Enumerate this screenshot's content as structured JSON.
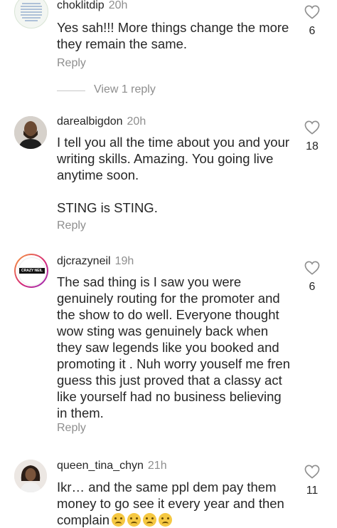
{
  "comments": [
    {
      "username": "choklitdip",
      "time": "20h",
      "paragraphs": [
        "Yes sah!!! More things change the more they remain the same."
      ],
      "reply_label": "Reply",
      "likes": "6",
      "view_replies": "View 1 reply"
    },
    {
      "username": "darealbigdon",
      "time": "20h",
      "paragraphs": [
        "I tell you all the time about you and your writing skills. Amazing. You going live anytime soon.",
        "STING is STING."
      ],
      "reply_label": "Reply",
      "likes": "18"
    },
    {
      "username": "djcrazyneil",
      "time": "19h",
      "paragraphs": [
        "The sad thing is I saw you were genuinely routing for the promoter and the show to do well. Everyone thought wow sting was genuinely back when they saw legends like you booked and promoting it . Nuh worry youself me fren guess this just proved that a classy act like yourself had no business believing in them."
      ],
      "reply_label": "Reply",
      "likes": "6",
      "avatar_logo_text": "CRAZY NEIL"
    },
    {
      "username": "queen_tina_chyn",
      "time": "21h",
      "paragraphs": [
        "Ikr… and the same ppl dem pay them money to go see it every year and then complain"
      ],
      "reply_label": "Reply",
      "likes": "11"
    }
  ],
  "icons": {
    "like": "heart-outline-icon",
    "emoji": "sad-face-emoji"
  }
}
